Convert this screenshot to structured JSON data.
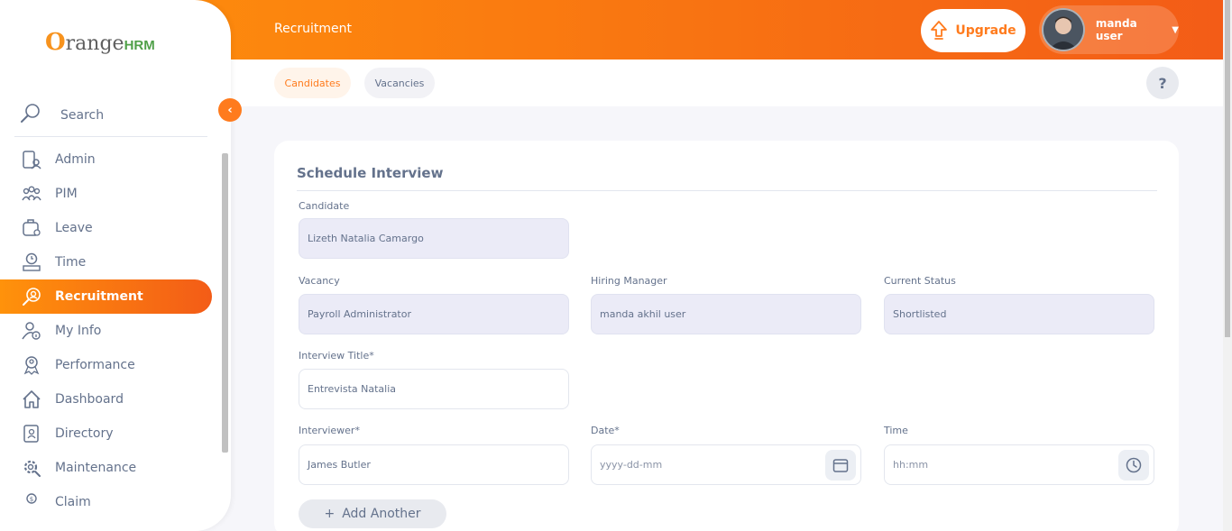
{
  "brand": {
    "logo_text": "range",
    "logo_o": "O",
    "logo_hrm": "HRM"
  },
  "header": {
    "title": "Recruitment",
    "upgrade_label": "Upgrade",
    "user_name": "manda user"
  },
  "subnav": {
    "tabs": [
      {
        "label": "Candidates",
        "active": true
      },
      {
        "label": "Vacancies",
        "active": false
      }
    ],
    "help_label": "?"
  },
  "sidebar": {
    "search_label": "Search",
    "items": [
      {
        "label": "Admin",
        "icon": "admin-icon"
      },
      {
        "label": "PIM",
        "icon": "pim-icon"
      },
      {
        "label": "Leave",
        "icon": "leave-icon"
      },
      {
        "label": "Time",
        "icon": "time-icon"
      },
      {
        "label": "Recruitment",
        "icon": "recruitment-icon",
        "active": true
      },
      {
        "label": "My Info",
        "icon": "my-info-icon"
      },
      {
        "label": "Performance",
        "icon": "performance-icon"
      },
      {
        "label": "Dashboard",
        "icon": "dashboard-icon"
      },
      {
        "label": "Directory",
        "icon": "directory-icon"
      },
      {
        "label": "Maintenance",
        "icon": "maintenance-icon"
      },
      {
        "label": "Claim",
        "icon": "claim-icon"
      }
    ]
  },
  "form": {
    "heading": "Schedule Interview",
    "candidate": {
      "label": "Candidate",
      "value": "Lizeth Natalia Camargo"
    },
    "vacancy": {
      "label": "Vacancy",
      "value": "Payroll Administrator"
    },
    "hiring_manager": {
      "label": "Hiring Manager",
      "value": "manda akhil user"
    },
    "current_status": {
      "label": "Current Status",
      "value": "Shortlisted"
    },
    "interview_title": {
      "label": "Interview Title*",
      "value": "Entrevista Natalia"
    },
    "interviewer": {
      "label": "Interviewer*",
      "value": "James  Butler"
    },
    "date": {
      "label": "Date*",
      "placeholder": "yyyy-dd-mm"
    },
    "time": {
      "label": "Time",
      "placeholder": "hh:mm"
    },
    "add_another_label": "Add Another",
    "add_another_symbol": "+"
  },
  "colors": {
    "accent": "#ff7b1d",
    "gradient_start": "#ff920b",
    "gradient_end": "#f35c17",
    "text": "#64728c"
  }
}
